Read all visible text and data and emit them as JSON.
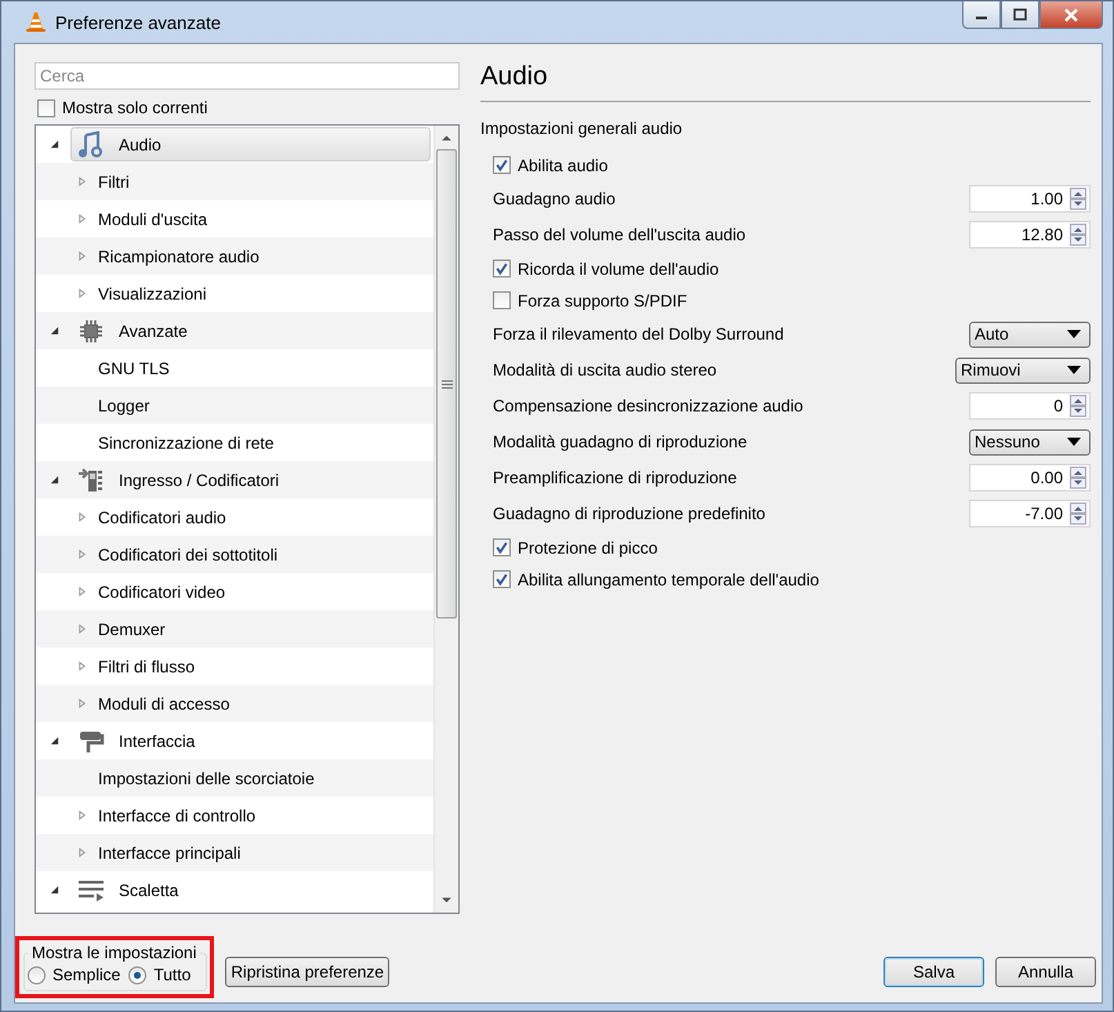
{
  "window": {
    "title": "Preferenze avanzate"
  },
  "search": {
    "placeholder": "Cerca"
  },
  "show_current_only": {
    "label": "Mostra solo correnti",
    "checked": false
  },
  "tree": [
    {
      "label": "Audio",
      "selected": true,
      "expanded": true,
      "children": [
        {
          "label": "Filtri",
          "expandable": true
        },
        {
          "label": "Moduli d'uscita",
          "expandable": true
        },
        {
          "label": "Ricampionatore audio",
          "expandable": true
        },
        {
          "label": "Visualizzazioni",
          "expandable": true
        }
      ]
    },
    {
      "label": "Avanzate",
      "selected": false,
      "expanded": true,
      "children": [
        {
          "label": "GNU TLS",
          "expandable": false
        },
        {
          "label": "Logger",
          "expandable": false
        },
        {
          "label": "Sincronizzazione di rete",
          "expandable": false
        }
      ]
    },
    {
      "label": "Ingresso / Codificatori",
      "selected": false,
      "expanded": true,
      "children": [
        {
          "label": "Codificatori audio",
          "expandable": true
        },
        {
          "label": "Codificatori dei sottotitoli",
          "expandable": true
        },
        {
          "label": "Codificatori video",
          "expandable": true
        },
        {
          "label": "Demuxer",
          "expandable": true
        },
        {
          "label": "Filtri di flusso",
          "expandable": true
        },
        {
          "label": "Moduli di accesso",
          "expandable": true
        }
      ]
    },
    {
      "label": "Interfaccia",
      "selected": false,
      "expanded": true,
      "children": [
        {
          "label": "Impostazioni delle scorciatoie",
          "expandable": false
        },
        {
          "label": "Interfacce di controllo",
          "expandable": true
        },
        {
          "label": "Interfacce principali",
          "expandable": true
        }
      ]
    },
    {
      "label": "Scaletta",
      "selected": false,
      "expanded": true
    }
  ],
  "panel": {
    "title": "Audio",
    "section": "Impostazioni generali audio"
  },
  "settings": [
    {
      "kind": "checkbox",
      "label": "Abilita audio",
      "checked": true
    },
    {
      "kind": "spin",
      "label": "Guadagno audio",
      "value": "1.00"
    },
    {
      "kind": "spin",
      "label": "Passo del volume dell'uscita audio",
      "value": "12.80"
    },
    {
      "kind": "checkbox",
      "label": "Ricorda il volume dell'audio",
      "checked": true
    },
    {
      "kind": "checkbox",
      "label": "Forza supporto S/PDIF",
      "checked": false
    },
    {
      "kind": "dropdown",
      "label": "Forza il rilevamento del Dolby Surround",
      "value": "Auto",
      "wide": false
    },
    {
      "kind": "dropdown",
      "label": "Modalità di uscita audio stereo",
      "value": "Rimuovi",
      "wide": true
    },
    {
      "kind": "spin",
      "label": "Compensazione desincronizzazione audio",
      "value": "0"
    },
    {
      "kind": "dropdown",
      "label": "Modalità guadagno di riproduzione",
      "value": "Nessuno",
      "wide": false
    },
    {
      "kind": "spin",
      "label": "Preamplificazione di riproduzione",
      "value": "0.00"
    },
    {
      "kind": "spin",
      "label": "Guadagno di riproduzione predefinito",
      "value": "-7.00"
    },
    {
      "kind": "checkbox",
      "label": "Protezione di picco",
      "checked": true
    },
    {
      "kind": "checkbox",
      "label": "Abilita allungamento temporale dell'audio",
      "checked": true
    }
  ],
  "show_settings": {
    "title": "Mostra le impostazioni",
    "options": [
      {
        "label": "Semplice",
        "selected": false
      },
      {
        "label": "Tutto",
        "selected": true
      }
    ]
  },
  "buttons": {
    "reset": "Ripristina preferenze",
    "save": "Salva",
    "cancel": "Annulla"
  }
}
